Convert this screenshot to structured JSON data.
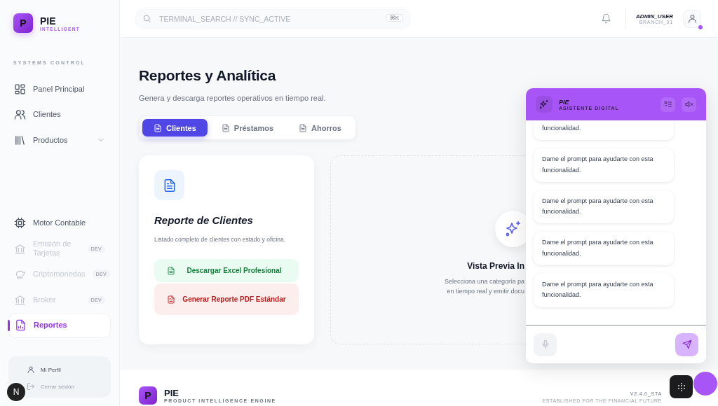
{
  "brand": {
    "letter": "P",
    "name": "PIE",
    "tagline": "INTELLIGENT"
  },
  "sidebar": {
    "section": "SYSTEMS CONTROL",
    "items": [
      {
        "label": "Panel Principal",
        "kind": "link",
        "selected": false,
        "disabled": false
      },
      {
        "label": "Clientes",
        "kind": "link",
        "selected": false,
        "disabled": false
      },
      {
        "label": "Productos",
        "kind": "group",
        "selected": false,
        "disabled": false
      },
      {
        "label": "Motor Contable",
        "kind": "link",
        "selected": false,
        "disabled": false
      },
      {
        "label": "Emisión de Tarjetas",
        "kind": "link",
        "selected": false,
        "disabled": true,
        "badge": "DEV"
      },
      {
        "label": "Criptomonedas",
        "kind": "link",
        "selected": false,
        "disabled": true,
        "badge": "DEV"
      },
      {
        "label": "Broker",
        "kind": "link",
        "selected": false,
        "disabled": true,
        "badge": "DEV"
      },
      {
        "label": "Reportes",
        "kind": "link",
        "selected": true,
        "disabled": false
      }
    ],
    "account": [
      "Mi Perfil",
      "Cerrar sesión"
    ]
  },
  "dev_badge": "N",
  "topbar": {
    "search": {
      "placeholder": "TERMINAL_SEARCH // SYNC_ACTIVE",
      "shortcut": "⌘K"
    },
    "user": {
      "name": "ADMIN_USER",
      "branch": "BRANCH_01",
      "online": true
    }
  },
  "page": {
    "title": "Reportes y Analítica",
    "subtitle": "Genera y descarga reportes operativos en tiempo real.",
    "tabs": [
      {
        "label": "Clientes",
        "selected": true
      },
      {
        "label": "Préstamos",
        "selected": false
      },
      {
        "label": "Ahorros",
        "selected": false
      }
    ],
    "report_card": {
      "title": "Reporte de Clientes",
      "description": "Listado completo de clientes con estado y oficina.",
      "actions": [
        {
          "label": "Descargar Excel Profesional",
          "kind": "excel"
        },
        {
          "label": "Generar Reporte PDF Estándar",
          "kind": "pdf"
        }
      ]
    },
    "preview": {
      "title": "Vista Previa In",
      "lines": [
        "Selecciona una categoría pa",
        "en tiempo real y emitir docu"
      ]
    }
  },
  "footer": {
    "letter": "P",
    "name": "PIE",
    "tagline": "PRODUCT INTELLIGENCE ENGINE",
    "version": "V2.4.0_STA",
    "motto": "ESTABLISHED FOR THE FINANCIAL FUTURE"
  },
  "chat": {
    "title": "PIE",
    "subtitle": "ASISTENTE DIGITAL",
    "messages": [
      "funcionalidad.",
      "Dame el prompt para ayudarte con esta funcionalidad.",
      "Dame el prompt para ayudarte con esta funcionalidad.",
      "Dame el prompt para ayudarte con esta funcionalidad.",
      "Dame el prompt para ayudarte con esta funcionalidad."
    ]
  }
}
